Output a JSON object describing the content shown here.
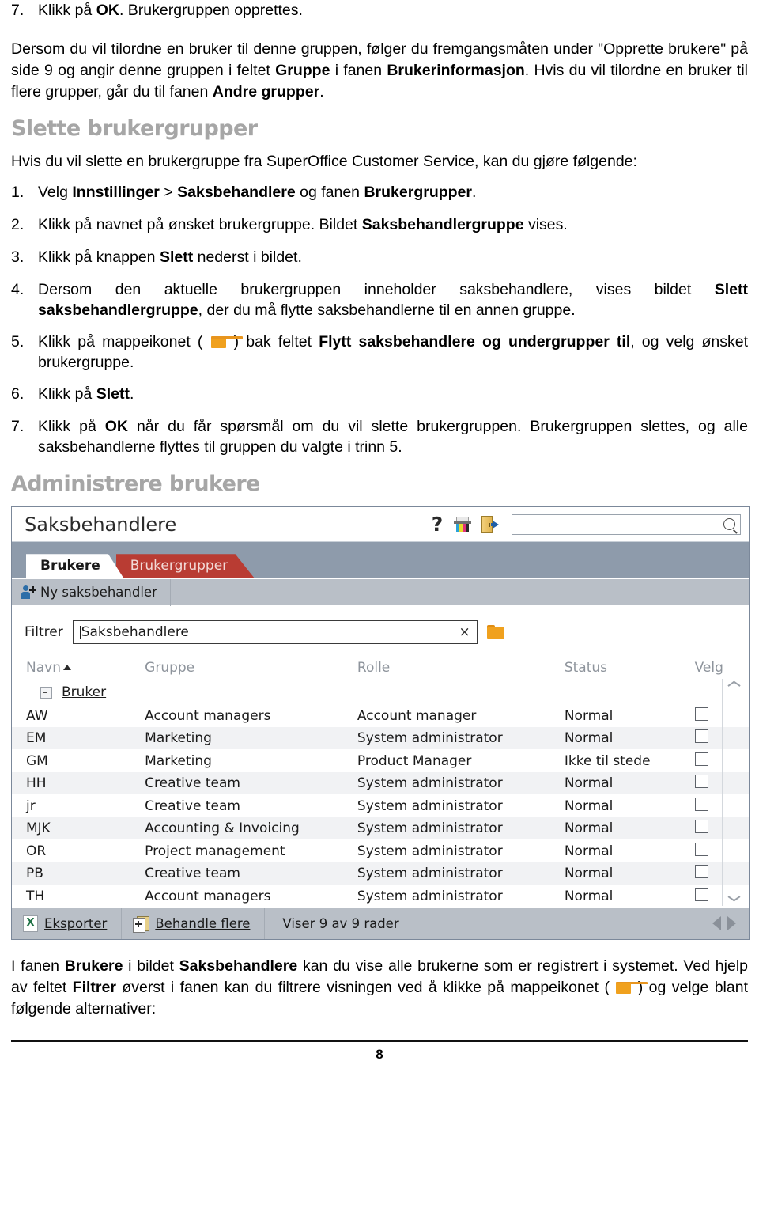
{
  "document": {
    "top_list": [
      {
        "num": "7.",
        "segments": [
          {
            "t": "Klikk på ",
            "b": false
          },
          {
            "t": "OK",
            "b": true
          },
          {
            "t": ". Brukergruppen opprettes.",
            "b": false
          }
        ]
      }
    ],
    "intro_paragraph": [
      {
        "t": "Dersom du vil tilordne en bruker til denne gruppen, følger du fremgangsmåten under \"Opprette brukere\" på side 9 og angir denne gruppen i feltet ",
        "b": false
      },
      {
        "t": "Gruppe",
        "b": true
      },
      {
        "t": " i fanen ",
        "b": false
      },
      {
        "t": "Brukerinformasjon",
        "b": true
      },
      {
        "t": ". Hvis du vil tilordne en bruker til flere grupper, går du til fanen ",
        "b": false
      },
      {
        "t": "Andre grupper",
        "b": true
      },
      {
        "t": ".",
        "b": false
      }
    ],
    "heading_1": "Slette brukergrupper",
    "lead_paragraph": [
      {
        "t": "Hvis du vil slette en brukergruppe fra SuperOffice Customer Service, kan du gjøre følgende:",
        "b": false
      }
    ],
    "steps": [
      {
        "num": "1.",
        "segments": [
          {
            "t": "Velg ",
            "b": false
          },
          {
            "t": "Innstillinger",
            "b": true
          },
          {
            "t": " > ",
            "b": false
          },
          {
            "t": "Saksbehandlere",
            "b": true
          },
          {
            "t": " og fanen ",
            "b": false
          },
          {
            "t": "Brukergrupper",
            "b": true
          },
          {
            "t": ".",
            "b": false
          }
        ]
      },
      {
        "num": "2.",
        "segments": [
          {
            "t": "Klikk på navnet på ønsket brukergruppe. Bildet ",
            "b": false
          },
          {
            "t": "Saksbehandlergruppe",
            "b": true
          },
          {
            "t": " vises.",
            "b": false
          }
        ]
      },
      {
        "num": "3.",
        "segments": [
          {
            "t": "Klikk på knappen ",
            "b": false
          },
          {
            "t": "Slett",
            "b": true
          },
          {
            "t": " nederst i bildet.",
            "b": false
          }
        ]
      },
      {
        "num": "4.",
        "justify": true,
        "segments": [
          {
            "t": "Dersom den aktuelle brukergruppen inneholder saksbehandlere, vises bildet ",
            "b": false
          },
          {
            "t": "Slett saksbehandlergruppe",
            "b": true
          },
          {
            "t": ", der du må flytte saksbehandlerne til en annen gruppe.",
            "b": false
          }
        ]
      },
      {
        "num": "5.",
        "justify": true,
        "segments": [
          {
            "t": "Klikk på mappeikonet ( ",
            "b": false
          },
          {
            "t": "__FOLDER__",
            "b": false
          },
          {
            "t": " ) bak feltet ",
            "b": false
          },
          {
            "t": "Flytt saksbehandlere og undergrupper til",
            "b": true
          },
          {
            "t": ", og velg ønsket brukergruppe.",
            "b": false
          }
        ]
      },
      {
        "num": "6.",
        "segments": [
          {
            "t": "Klikk på ",
            "b": false
          },
          {
            "t": "Slett",
            "b": true
          },
          {
            "t": ".",
            "b": false
          }
        ]
      },
      {
        "num": "7.",
        "justify": true,
        "segments": [
          {
            "t": "Klikk på ",
            "b": false
          },
          {
            "t": "OK",
            "b": true
          },
          {
            "t": " når du får spørsmål om du vil slette brukergruppen. Brukergruppen slettes, og alle saksbehandlerne flyttes til gruppen du valgte i trinn 5.",
            "b": false
          }
        ]
      }
    ],
    "heading_2": "Administrere brukere",
    "closing_paragraph": [
      {
        "t": "I fanen ",
        "b": false
      },
      {
        "t": "Brukere",
        "b": true
      },
      {
        "t": " i bildet ",
        "b": false
      },
      {
        "t": "Saksbehandlere",
        "b": true
      },
      {
        "t": " kan du vise alle brukerne som er registrert i systemet. Ved hjelp av feltet ",
        "b": false
      },
      {
        "t": "Filtrer",
        "b": true
      },
      {
        "t": " øverst i fanen kan du filtrere visningen ved å klikke på mappeikonet ( ",
        "b": false
      },
      {
        "t": "__FOLDER__",
        "b": false
      },
      {
        "t": " ) og velge blant følgende alternativer:",
        "b": false
      }
    ],
    "page_number": "8"
  },
  "screenshot": {
    "app_title": "Saksbehandlere",
    "toolbar_icons": [
      "help-icon",
      "print-colors-icon",
      "logout-icon"
    ],
    "search": {
      "value": "",
      "placeholder": ""
    },
    "tabs": [
      {
        "label": "Brukere",
        "active": true
      },
      {
        "label": "Brukergrupper",
        "active": false
      }
    ],
    "action_bar": {
      "new_user_label": "Ny saksbehandler"
    },
    "filter": {
      "label": "Filtrer",
      "value": "Saksbehandlere",
      "clear_label": "×",
      "folder_icon": "folder-icon"
    },
    "grid": {
      "columns": [
        "Navn",
        "Gruppe",
        "Rolle",
        "Status",
        "Velg"
      ],
      "sort_column": "Navn",
      "sort_direction": "asc",
      "group_row": {
        "label": "Bruker",
        "expanded": true
      },
      "rows": [
        {
          "navn": "AW",
          "gruppe": "Account managers",
          "rolle": "Account manager",
          "status": "Normal",
          "velg": false
        },
        {
          "navn": "EM",
          "gruppe": "Marketing",
          "rolle": "System administrator",
          "status": "Normal",
          "velg": false
        },
        {
          "navn": "GM",
          "gruppe": "Marketing",
          "rolle": "Product Manager",
          "status": "Ikke til stede",
          "velg": false
        },
        {
          "navn": "HH",
          "gruppe": "Creative team",
          "rolle": "System administrator",
          "status": "Normal",
          "velg": false
        },
        {
          "navn": "jr",
          "gruppe": "Creative team",
          "rolle": "System administrator",
          "status": "Normal",
          "velg": false
        },
        {
          "navn": "MJK",
          "gruppe": "Accounting & Invoicing",
          "rolle": "System administrator",
          "status": "Normal",
          "velg": false
        },
        {
          "navn": "OR",
          "gruppe": "Project management",
          "rolle": "System administrator",
          "status": "Normal",
          "velg": false
        },
        {
          "navn": "PB",
          "gruppe": "Creative team",
          "rolle": "System administrator",
          "status": "Normal",
          "velg": false
        },
        {
          "navn": "TH",
          "gruppe": "Account managers",
          "rolle": "System administrator",
          "status": "Normal",
          "velg": false
        }
      ]
    },
    "footer": {
      "export_label": "Eksporter",
      "bulk_label": "Behandle flere",
      "status_text": "Viser 9 av 9 rader"
    },
    "colors": {
      "chrome": "#8e9bab",
      "tab_active_bg": "#ffffff",
      "tab_inactive_bg": "#b93c33",
      "bar_bg": "#b9bfc7",
      "folder_orange": "#f0a11e",
      "heading_gray": "#a6a6a6"
    }
  }
}
